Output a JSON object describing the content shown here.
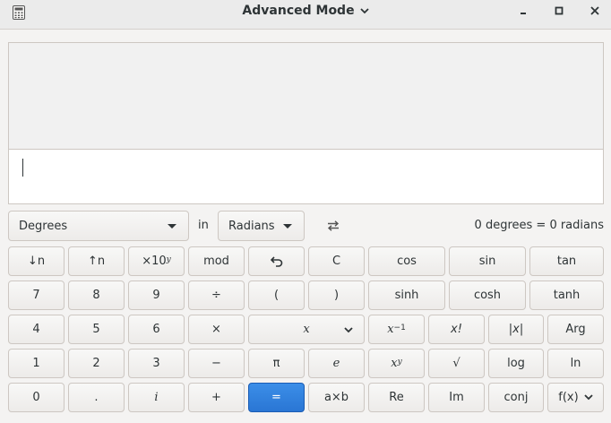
{
  "window": {
    "title": "Advanced Mode",
    "icons": [
      "calculator-icon",
      "chevron-down-icon",
      "minimize-icon",
      "maximize-icon",
      "close-icon"
    ]
  },
  "conversion": {
    "from_unit": "Degrees",
    "in_label": "in",
    "to_unit": "Radians",
    "result": "0 degrees  =  0 radians"
  },
  "keypad": {
    "row1": {
      "down_n": "↓n",
      "up_n": "↑n",
      "times10": "×10",
      "times10_sup": "y",
      "mod": "mod",
      "clear": "C",
      "cos": "cos",
      "sin": "sin",
      "tan": "tan"
    },
    "row2": {
      "k7": "7",
      "k8": "8",
      "k9": "9",
      "divide": "÷",
      "lparen": "(",
      "rparen": ")",
      "sinh": "sinh",
      "cosh": "cosh",
      "tanh": "tanh"
    },
    "row3": {
      "k4": "4",
      "k5": "5",
      "k6": "6",
      "multiply": "×",
      "variable": "x",
      "inverse_base": "x",
      "inverse_sup": "−1",
      "factorial": "x!",
      "abs": "|x|",
      "arg": "Arg"
    },
    "row4": {
      "k1": "1",
      "k2": "2",
      "k3": "3",
      "minus": "−",
      "pi": "π",
      "e": "e",
      "power_base": "x",
      "power_sup": "y",
      "sqrt": "√",
      "log": "log",
      "ln": "ln"
    },
    "row5": {
      "k0": "0",
      "point": ".",
      "imag": "i",
      "plus": "+",
      "equals": "=",
      "sci": "a×b",
      "re": "Re",
      "im": "Im",
      "conj": "conj",
      "fx": "f(x)"
    }
  }
}
